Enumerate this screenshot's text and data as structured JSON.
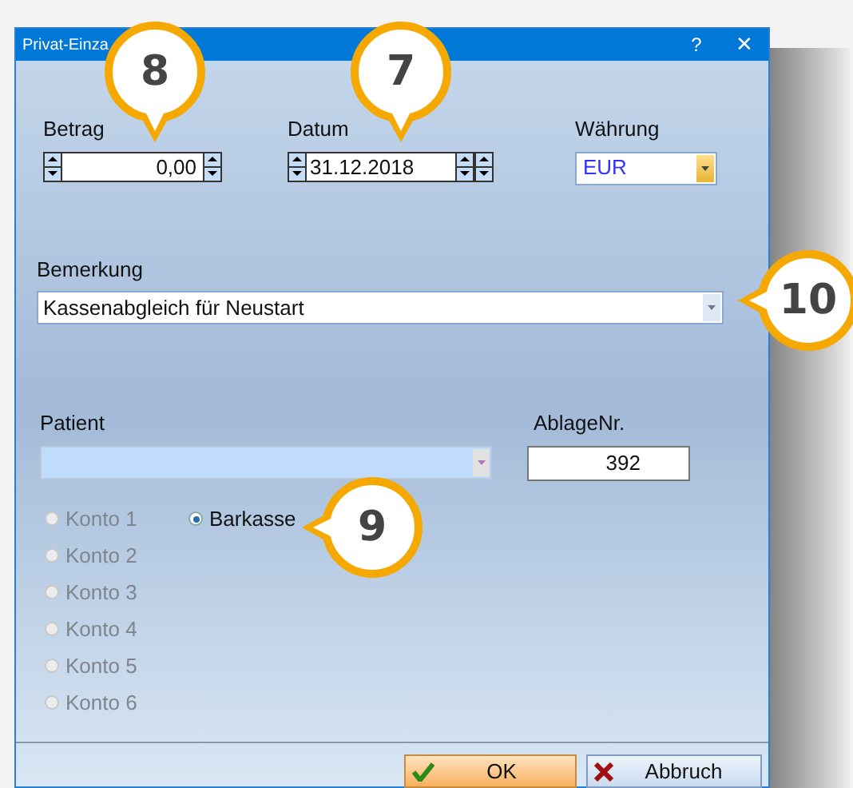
{
  "window": {
    "title": "Privat-Einza",
    "buttons": [
      "?",
      "✕"
    ]
  },
  "betrag": {
    "label": "Betrag",
    "value": "0,00"
  },
  "datum": {
    "label": "Datum",
    "value": "31.12.2018"
  },
  "waehrung": {
    "label": "Währung",
    "value": "EUR"
  },
  "bemerkung": {
    "label": "Bemerkung",
    "value": "Kassenabgleich für Neustart"
  },
  "patient": {
    "label": "Patient",
    "disabled": true
  },
  "ablage": {
    "label": "AblageNr.",
    "value": "392"
  },
  "accounts": [
    {
      "label": "Konto 1",
      "selected": false,
      "disabled": true
    },
    {
      "label": "Konto 2",
      "selected": false,
      "disabled": true
    },
    {
      "label": "Konto 3",
      "selected": false,
      "disabled": true
    },
    {
      "label": "Konto 4",
      "selected": false,
      "disabled": true
    },
    {
      "label": "Konto 5",
      "selected": false,
      "disabled": true
    },
    {
      "label": "Konto 6",
      "selected": false,
      "disabled": true
    }
  ],
  "cash_option": {
    "label": "Barkasse",
    "selected": true,
    "disabled": false
  },
  "buttons": [
    {
      "label": "OK",
      "kind": "ok"
    },
    {
      "label": "Abbruch",
      "kind": "cancel"
    }
  ],
  "callouts": [
    {
      "label": "8"
    },
    {
      "label": "7"
    },
    {
      "label": "10"
    },
    {
      "label": "9"
    }
  ]
}
